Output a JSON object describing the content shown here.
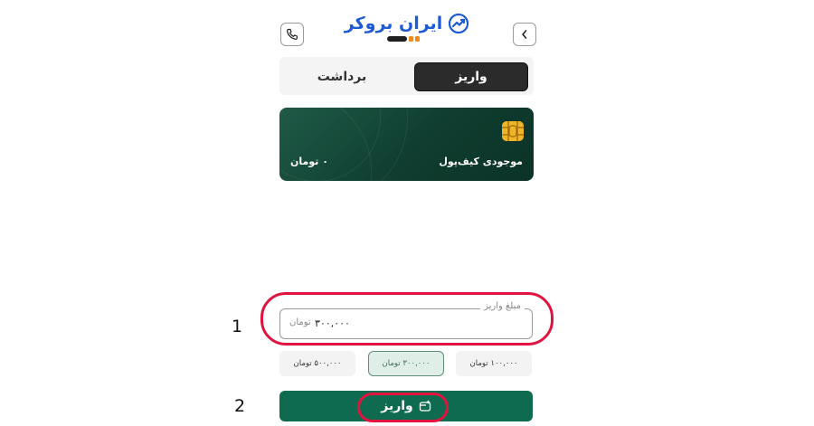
{
  "header": {
    "logo_text": "ایران بروکر",
    "back_icon": "chevron-left-icon",
    "support_icon": "phone-icon"
  },
  "tabs": [
    {
      "label": "واریز",
      "active": true
    },
    {
      "label": "برداشت",
      "active": false
    }
  ],
  "wallet": {
    "label": "موجودی کیف‌پول",
    "balance": "۰ تومان",
    "chip_icon": "card-chip-icon"
  },
  "amount_field": {
    "legend": "مبلغ واریز",
    "value": "۳۰۰,۰۰۰",
    "unit": "تومان"
  },
  "presets": [
    {
      "label": "۵۰۰,۰۰۰ تومان",
      "selected": false
    },
    {
      "label": "۳۰۰,۰۰۰ تومان",
      "selected": true
    },
    {
      "label": "۱۰۰,۰۰۰ تومان",
      "selected": false
    }
  ],
  "submit": {
    "label": "واریز",
    "icon": "deposit-card-icon"
  },
  "annotations": {
    "marker_1": "1",
    "marker_2": "2"
  },
  "colors": {
    "accent_green": "#0f6b4f",
    "card_green": "#0f3d2f",
    "highlight_red": "#e11440",
    "logo_blue": "#1e5ad6"
  }
}
